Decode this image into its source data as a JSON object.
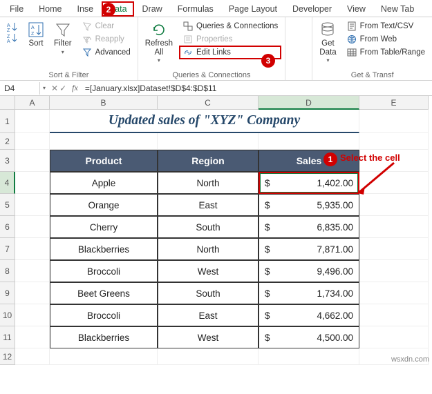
{
  "tabs": {
    "file": "File",
    "home": "Home",
    "insert": "Inse",
    "data": "Data",
    "draw": "Draw",
    "formulas": "Formulas",
    "page_layout": "Page Layout",
    "developer": "Developer",
    "view": "View",
    "new_tab": "New Tab"
  },
  "ribbon": {
    "sort_filter": {
      "sort": "Sort",
      "filter": "Filter",
      "clear": "Clear",
      "reapply": "Reapply",
      "advanced": "Advanced",
      "group": "Sort & Filter"
    },
    "queries": {
      "refresh": "Refresh\nAll",
      "queries_conn": "Queries & Connections",
      "properties": "Properties",
      "edit_links": "Edit Links",
      "group": "Queries & Connections"
    },
    "get": {
      "get_data": "Get\nData",
      "from_text": "From Text/CSV",
      "from_web": "From Web",
      "from_table": "From Table/Range",
      "group": "Get & Transf"
    }
  },
  "formula_bar": {
    "namebox": "D4",
    "formula": "=[January.xlsx]Dataset!$D$4:$D$11"
  },
  "columns": [
    "A",
    "B",
    "C",
    "D",
    "E"
  ],
  "rows": [
    "1",
    "2",
    "3",
    "4",
    "5",
    "6",
    "7",
    "8",
    "9",
    "10",
    "11",
    "12"
  ],
  "title": "Updated sales of \"XYZ\" Company",
  "headers": {
    "product": "Product",
    "region": "Region",
    "sales": "Sales"
  },
  "table": [
    {
      "product": "Apple",
      "region": "North",
      "sales": "1,402.00"
    },
    {
      "product": "Orange",
      "region": "East",
      "sales": "5,935.00"
    },
    {
      "product": "Cherry",
      "region": "South",
      "sales": "6,835.00"
    },
    {
      "product": "Blackberries",
      "region": "North",
      "sales": "7,871.00"
    },
    {
      "product": "Broccoli",
      "region": "West",
      "sales": "9,496.00"
    },
    {
      "product": "Beet Greens",
      "region": "South",
      "sales": "1,734.00"
    },
    {
      "product": "Broccoli",
      "region": "East",
      "sales": "4,662.00"
    },
    {
      "product": "Blackberries",
      "region": "West",
      "sales": "4,500.00"
    }
  ],
  "currency": "$",
  "annotations": {
    "b1": "1",
    "b2": "2",
    "b3": "3",
    "select_note": "Select the cell"
  },
  "watermark": "wsxdn.com",
  "chart_data": {
    "type": "table",
    "title": "Updated sales of \"XYZ\" Company",
    "columns": [
      "Product",
      "Region",
      "Sales"
    ],
    "rows": [
      [
        "Apple",
        "North",
        1402.0
      ],
      [
        "Orange",
        "East",
        5935.0
      ],
      [
        "Cherry",
        "South",
        6835.0
      ],
      [
        "Blackberries",
        "North",
        7871.0
      ],
      [
        "Broccoli",
        "West",
        9496.0
      ],
      [
        "Beet Greens",
        "South",
        1734.0
      ],
      [
        "Broccoli",
        "East",
        4662.0
      ],
      [
        "Blackberries",
        "West",
        4500.0
      ]
    ]
  }
}
